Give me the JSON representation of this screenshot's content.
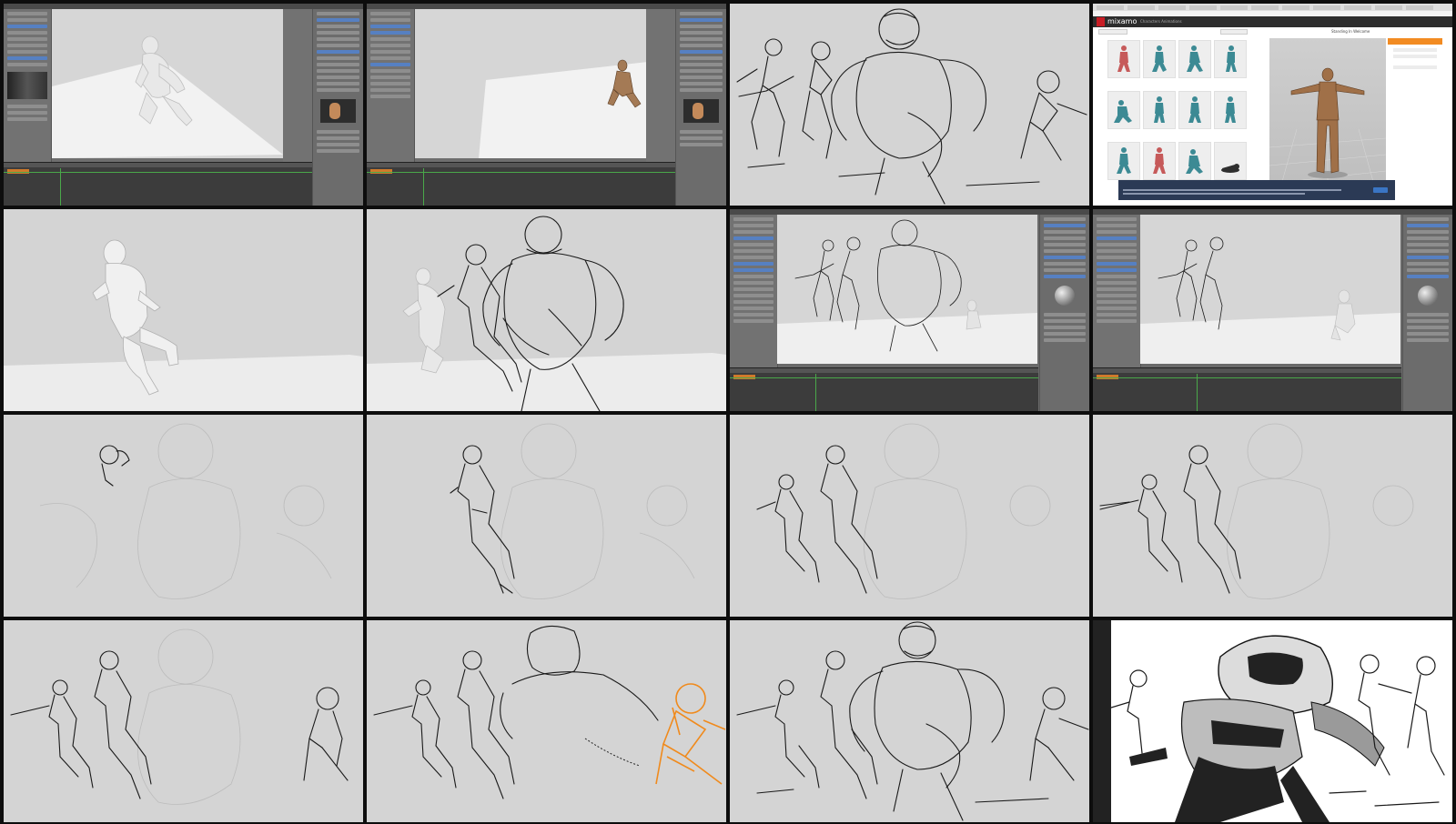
{
  "layout": {
    "rows": 4,
    "columns": 4
  },
  "tiles": [
    {
      "index": 1,
      "kind": "blender-viewport",
      "content": "grey-mannequin-crouch"
    },
    {
      "index": 2,
      "kind": "blender-viewport",
      "content": "textured-character-far"
    },
    {
      "index": 3,
      "kind": "sketch",
      "content": "full-lineart-composition"
    },
    {
      "index": 4,
      "kind": "browser-mixamo",
      "content": "animation-library"
    },
    {
      "index": 5,
      "kind": "render",
      "content": "grey-soldier-running"
    },
    {
      "index": 6,
      "kind": "sketch",
      "content": "roughs-over-render"
    },
    {
      "index": 7,
      "kind": "blender-viewport",
      "content": "sketch-over-scene"
    },
    {
      "index": 8,
      "kind": "blender-viewport",
      "content": "scene-with-figures"
    },
    {
      "index": 9,
      "kind": "sketch",
      "content": "helmet-start"
    },
    {
      "index": 10,
      "kind": "sketch",
      "content": "one-soldier"
    },
    {
      "index": 11,
      "kind": "sketch",
      "content": "two-soldiers"
    },
    {
      "index": 12,
      "kind": "sketch",
      "content": "two-soldiers-rifle"
    },
    {
      "index": 13,
      "kind": "sketch",
      "content": "three-soldiers"
    },
    {
      "index": 14,
      "kind": "sketch",
      "content": "orange-highlight"
    },
    {
      "index": 15,
      "kind": "sketch",
      "content": "full-lineart-composition"
    },
    {
      "index": 16,
      "kind": "final-art",
      "content": "inked-comic-panel"
    }
  ],
  "browser": {
    "brand": "mixamo",
    "nav": "Characters    Animations",
    "preview_title": "Standing In Welcome"
  },
  "colors": {
    "background": "#0d0d0d",
    "canvas": "#d4d4d4",
    "blender_panel": "#727272",
    "timeline_green": "#4aa84a",
    "highlight_orange": "#f08a1c",
    "mixamo_red": "#c81d25",
    "mixamo_orange": "#f28b22"
  }
}
